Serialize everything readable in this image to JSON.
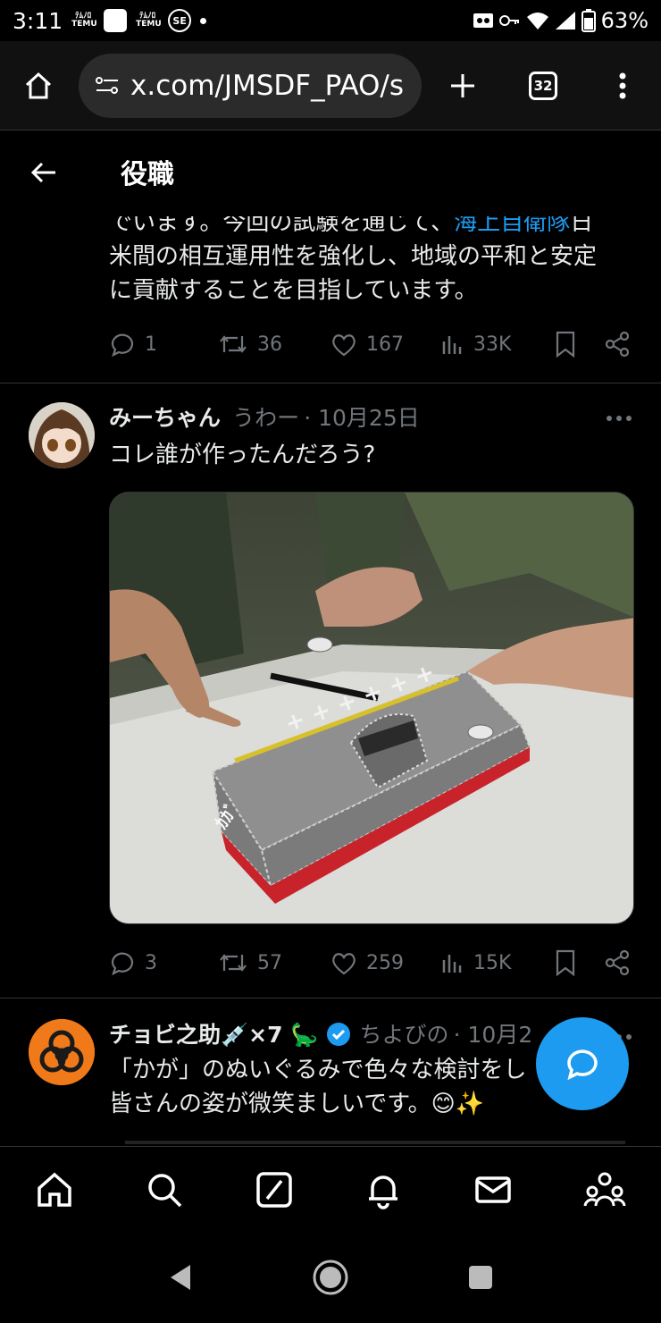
{
  "status_bar": {
    "time": "3:11",
    "temu_label": "ﾃﾑﾉﾛ\nTEMU",
    "se_label": "SE",
    "battery": "63%"
  },
  "browser": {
    "url": "x.com/JMSDF_PAO/s",
    "tab_count": "32"
  },
  "header": {
    "title": "役職"
  },
  "tweet1": {
    "line1_a": "でいます。今回の試験を通じて、",
    "line1_link": "海上自衛隊",
    "line1_b": "日",
    "line2": "米間の相互運用性を強化し、地域の平和と安定",
    "line3": "に貢献することを目指しています。",
    "replies": "1",
    "retweets": "36",
    "likes": "167",
    "views": "33K"
  },
  "tweet2": {
    "name": "みーちゃん",
    "handle": "うわー",
    "date": "· 10月25日",
    "text": "コレ誰が作ったんだろう?",
    "ship_text": "ｶｶﾞ",
    "replies": "3",
    "retweets": "57",
    "likes": "259",
    "views": "15K"
  },
  "tweet3": {
    "name": "チョビ之助💉×7 🦕",
    "handle": "ちよびの",
    "date": "· 10月2",
    "line1": "「かが」のぬいぐるみで色々な検討をし",
    "line2": "皆さんの姿が微笑ましいです。😊✨"
  },
  "colors": {
    "accent": "#1d9bf0",
    "muted": "#71767b",
    "background": "#000000"
  }
}
